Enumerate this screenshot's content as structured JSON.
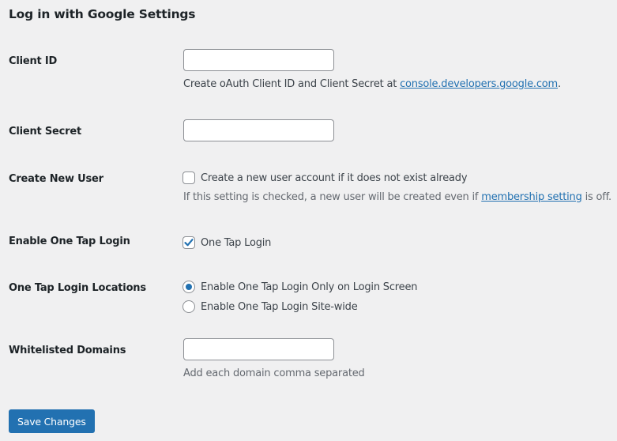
{
  "page": {
    "title": "Log in with Google Settings"
  },
  "fields": {
    "client_id": {
      "label": "Client ID",
      "value": "",
      "description_prefix": "Create oAuth Client ID and Client Secret at ",
      "description_link": "console.developers.google.com",
      "description_suffix": "."
    },
    "client_secret": {
      "label": "Client Secret",
      "value": ""
    },
    "create_new_user": {
      "label": "Create New User",
      "checkbox_label": "Create a new user account if it does not exist already",
      "checked": false,
      "description_prefix": "If this setting is checked, a new user will be created even if ",
      "description_link": "membership setting",
      "description_suffix": " is off."
    },
    "enable_one_tap": {
      "label": "Enable One Tap Login",
      "checkbox_label": "One Tap Login",
      "checked": true
    },
    "one_tap_locations": {
      "label": "One Tap Login Locations",
      "options": [
        {
          "label": "Enable One Tap Login Only on Login Screen",
          "selected": true
        },
        {
          "label": "Enable One Tap Login Site-wide",
          "selected": false
        }
      ]
    },
    "whitelisted_domains": {
      "label": "Whitelisted Domains",
      "value": "",
      "description": "Add each domain comma separated"
    }
  },
  "actions": {
    "save_label": "Save Changes"
  },
  "colors": {
    "accent": "#2271b1",
    "background": "#f0f0f1"
  }
}
